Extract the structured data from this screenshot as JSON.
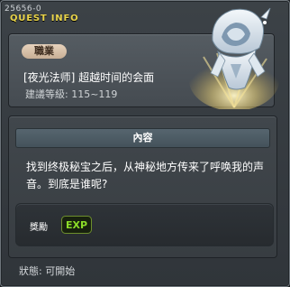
{
  "header": {
    "quest_id": "25656-0",
    "title": "QUEST INFO"
  },
  "quest": {
    "job_label": "職業",
    "title": "[夜光法师] 超越时间的会面",
    "level_label": "建議等級: 115~119"
  },
  "content": {
    "header": "內容",
    "description": "找到终极秘宝之后，从神秘地方传来了呼唤我的声音。到底是谁呢?"
  },
  "reward": {
    "label": "獎勵",
    "exp_text": "EXP"
  },
  "status": {
    "text": "狀態:  可開始"
  },
  "icons": {
    "npc": "hooded-mage-npc-icon",
    "exp": "exp-icon"
  },
  "colors": {
    "quest_info_title": "#e9d44b",
    "job_badge": "#d8c2aa",
    "exp_green": "#8bdc28"
  }
}
